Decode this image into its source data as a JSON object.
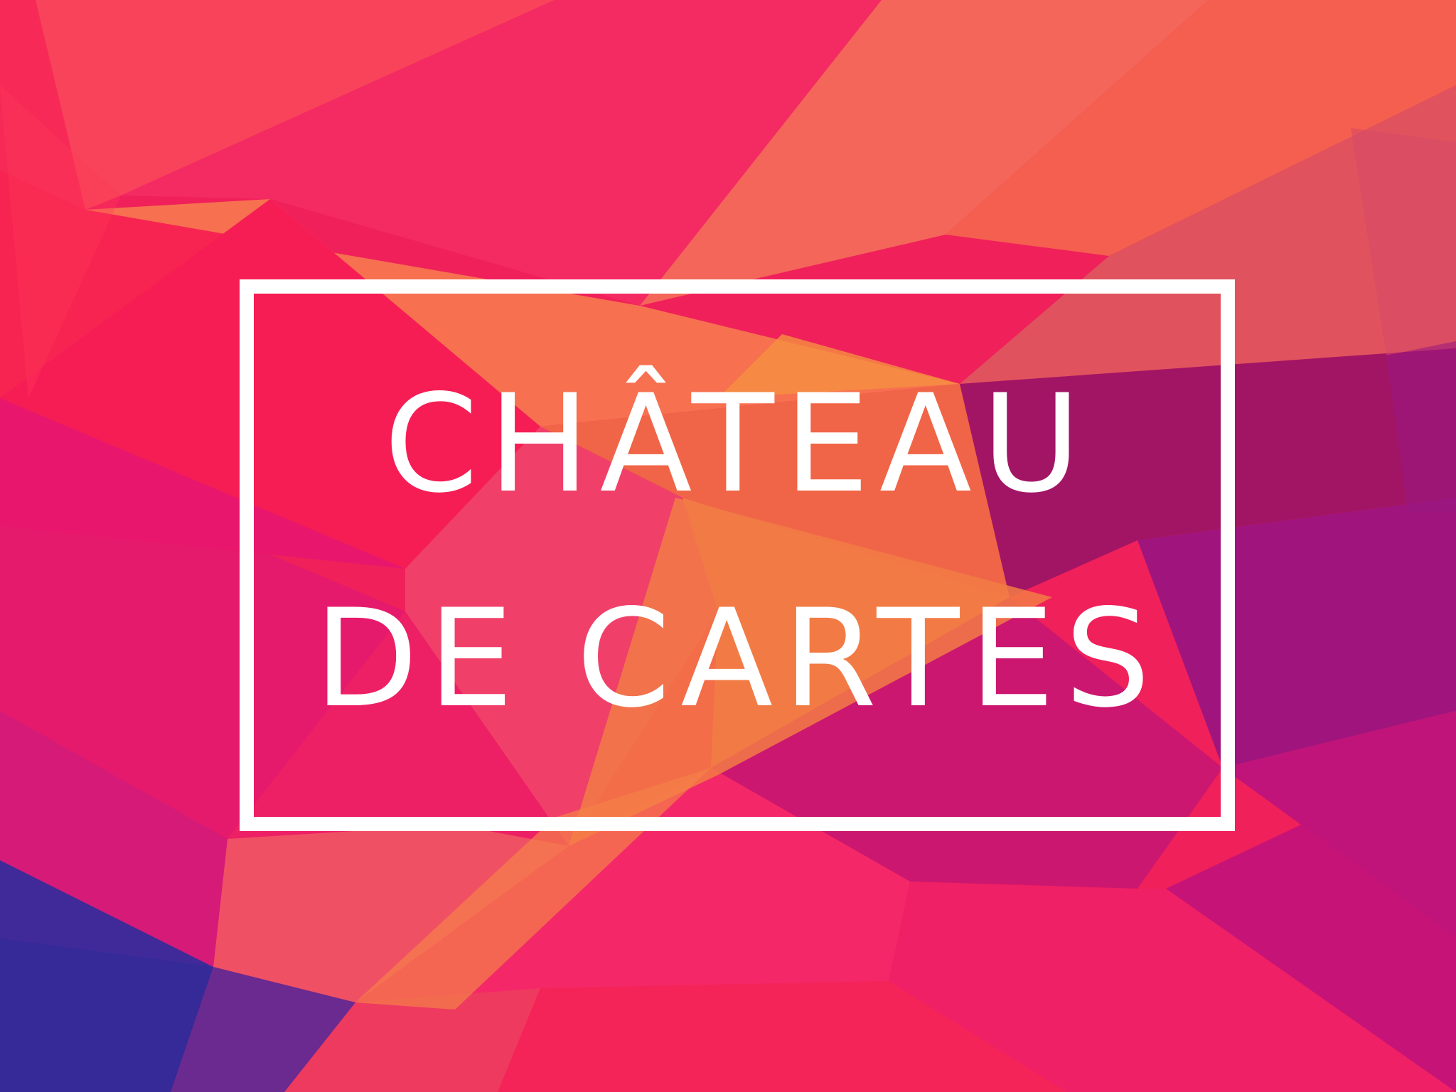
{
  "background": {
    "style": "low-poly-geometric",
    "palette": [
      "#f0205a",
      "#f46a4c",
      "#ff8a3a",
      "#a0117a",
      "#3a2a9a",
      "#e8196f"
    ]
  },
  "title": {
    "line1": "CHÂTEAU",
    "line2": "DE CARTES"
  },
  "frame": {
    "color": "#ffffff"
  }
}
